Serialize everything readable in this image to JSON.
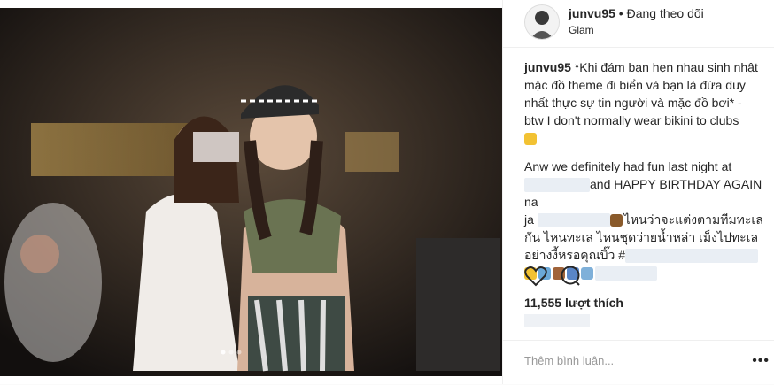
{
  "post": {
    "username": "junvu95",
    "follow_status": "• Đang theo dõi",
    "location": "Glam"
  },
  "caption": {
    "username": "junvu95",
    "text1": "*Khi đám bạn hẹn nhau sinh nhật mặc đồ theme đi biển và bạn là đứa duy nhất thực sự tin người và mặc đồ bơi* - btw I don't normally wear bikini to clubs",
    "line2a": "Anw we definitely had fun last night at",
    "line2b": "and HAPPY BIRTHDAY AGAIN na",
    "line2c": "ja",
    "thai": "ไหนว่าจะแต่งตามทีมทะเลกัน ไหนทะเล ไหนชุดว่ายน้ำหล่า เม็งไปทะเลอย่างงี้หรอคุณบิ๊ว",
    "hash": "#"
  },
  "likes": "11,555 lượt thích",
  "comment_placeholder": "Thêm bình luận...",
  "more_symbol": "•••",
  "icons": [
    "heart-icon",
    "comment-icon"
  ]
}
